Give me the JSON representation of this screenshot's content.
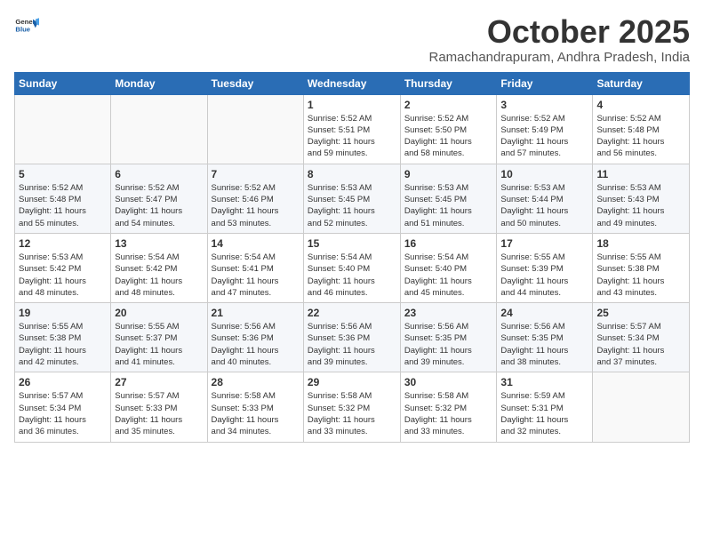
{
  "header": {
    "logo_general": "General",
    "logo_blue": "Blue",
    "month_title": "October 2025",
    "subtitle": "Ramachandrapuram, Andhra Pradesh, India"
  },
  "weekdays": [
    "Sunday",
    "Monday",
    "Tuesday",
    "Wednesday",
    "Thursday",
    "Friday",
    "Saturday"
  ],
  "weeks": [
    [
      {
        "day": "",
        "info": ""
      },
      {
        "day": "",
        "info": ""
      },
      {
        "day": "",
        "info": ""
      },
      {
        "day": "1",
        "info": "Sunrise: 5:52 AM\nSunset: 5:51 PM\nDaylight: 11 hours\nand 59 minutes."
      },
      {
        "day": "2",
        "info": "Sunrise: 5:52 AM\nSunset: 5:50 PM\nDaylight: 11 hours\nand 58 minutes."
      },
      {
        "day": "3",
        "info": "Sunrise: 5:52 AM\nSunset: 5:49 PM\nDaylight: 11 hours\nand 57 minutes."
      },
      {
        "day": "4",
        "info": "Sunrise: 5:52 AM\nSunset: 5:48 PM\nDaylight: 11 hours\nand 56 minutes."
      }
    ],
    [
      {
        "day": "5",
        "info": "Sunrise: 5:52 AM\nSunset: 5:48 PM\nDaylight: 11 hours\nand 55 minutes."
      },
      {
        "day": "6",
        "info": "Sunrise: 5:52 AM\nSunset: 5:47 PM\nDaylight: 11 hours\nand 54 minutes."
      },
      {
        "day": "7",
        "info": "Sunrise: 5:52 AM\nSunset: 5:46 PM\nDaylight: 11 hours\nand 53 minutes."
      },
      {
        "day": "8",
        "info": "Sunrise: 5:53 AM\nSunset: 5:45 PM\nDaylight: 11 hours\nand 52 minutes."
      },
      {
        "day": "9",
        "info": "Sunrise: 5:53 AM\nSunset: 5:45 PM\nDaylight: 11 hours\nand 51 minutes."
      },
      {
        "day": "10",
        "info": "Sunrise: 5:53 AM\nSunset: 5:44 PM\nDaylight: 11 hours\nand 50 minutes."
      },
      {
        "day": "11",
        "info": "Sunrise: 5:53 AM\nSunset: 5:43 PM\nDaylight: 11 hours\nand 49 minutes."
      }
    ],
    [
      {
        "day": "12",
        "info": "Sunrise: 5:53 AM\nSunset: 5:42 PM\nDaylight: 11 hours\nand 48 minutes."
      },
      {
        "day": "13",
        "info": "Sunrise: 5:54 AM\nSunset: 5:42 PM\nDaylight: 11 hours\nand 48 minutes."
      },
      {
        "day": "14",
        "info": "Sunrise: 5:54 AM\nSunset: 5:41 PM\nDaylight: 11 hours\nand 47 minutes."
      },
      {
        "day": "15",
        "info": "Sunrise: 5:54 AM\nSunset: 5:40 PM\nDaylight: 11 hours\nand 46 minutes."
      },
      {
        "day": "16",
        "info": "Sunrise: 5:54 AM\nSunset: 5:40 PM\nDaylight: 11 hours\nand 45 minutes."
      },
      {
        "day": "17",
        "info": "Sunrise: 5:55 AM\nSunset: 5:39 PM\nDaylight: 11 hours\nand 44 minutes."
      },
      {
        "day": "18",
        "info": "Sunrise: 5:55 AM\nSunset: 5:38 PM\nDaylight: 11 hours\nand 43 minutes."
      }
    ],
    [
      {
        "day": "19",
        "info": "Sunrise: 5:55 AM\nSunset: 5:38 PM\nDaylight: 11 hours\nand 42 minutes."
      },
      {
        "day": "20",
        "info": "Sunrise: 5:55 AM\nSunset: 5:37 PM\nDaylight: 11 hours\nand 41 minutes."
      },
      {
        "day": "21",
        "info": "Sunrise: 5:56 AM\nSunset: 5:36 PM\nDaylight: 11 hours\nand 40 minutes."
      },
      {
        "day": "22",
        "info": "Sunrise: 5:56 AM\nSunset: 5:36 PM\nDaylight: 11 hours\nand 39 minutes."
      },
      {
        "day": "23",
        "info": "Sunrise: 5:56 AM\nSunset: 5:35 PM\nDaylight: 11 hours\nand 39 minutes."
      },
      {
        "day": "24",
        "info": "Sunrise: 5:56 AM\nSunset: 5:35 PM\nDaylight: 11 hours\nand 38 minutes."
      },
      {
        "day": "25",
        "info": "Sunrise: 5:57 AM\nSunset: 5:34 PM\nDaylight: 11 hours\nand 37 minutes."
      }
    ],
    [
      {
        "day": "26",
        "info": "Sunrise: 5:57 AM\nSunset: 5:34 PM\nDaylight: 11 hours\nand 36 minutes."
      },
      {
        "day": "27",
        "info": "Sunrise: 5:57 AM\nSunset: 5:33 PM\nDaylight: 11 hours\nand 35 minutes."
      },
      {
        "day": "28",
        "info": "Sunrise: 5:58 AM\nSunset: 5:33 PM\nDaylight: 11 hours\nand 34 minutes."
      },
      {
        "day": "29",
        "info": "Sunrise: 5:58 AM\nSunset: 5:32 PM\nDaylight: 11 hours\nand 33 minutes."
      },
      {
        "day": "30",
        "info": "Sunrise: 5:58 AM\nSunset: 5:32 PM\nDaylight: 11 hours\nand 33 minutes."
      },
      {
        "day": "31",
        "info": "Sunrise: 5:59 AM\nSunset: 5:31 PM\nDaylight: 11 hours\nand 32 minutes."
      },
      {
        "day": "",
        "info": ""
      }
    ]
  ]
}
